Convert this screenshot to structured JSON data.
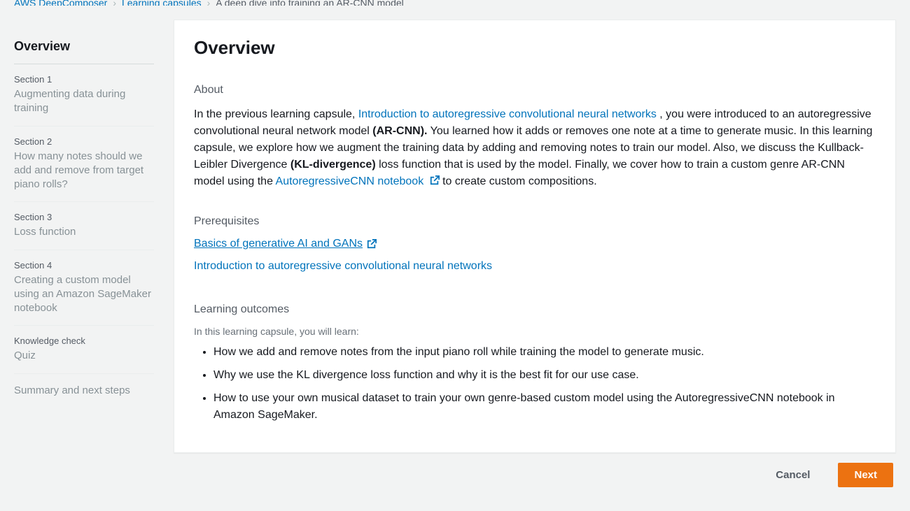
{
  "breadcrumb": {
    "item1": "AWS DeepComposer",
    "item2": "Learning capsules",
    "item3": "A deep dive into training an AR-CNN model"
  },
  "sidebar": {
    "heading": "Overview",
    "items": [
      {
        "label": "Section 1",
        "title": "Augmenting data during training"
      },
      {
        "label": "Section 2",
        "title": "How many notes should we add and remove from target piano rolls?"
      },
      {
        "label": "Section 3",
        "title": "Loss function"
      },
      {
        "label": "Section 4",
        "title": "Creating a custom model using an Amazon SageMaker notebook"
      },
      {
        "label": "Knowledge check",
        "title": "Quiz"
      },
      {
        "label": "",
        "title": "Summary and next steps"
      }
    ]
  },
  "main": {
    "title": "Overview",
    "about_label": "About",
    "about": {
      "p1": "In the previous learning capsule, ",
      "link1": "Introduction to autoregressive convolutional neural networks",
      "p2": " , you were introduced to an autoregressive convolutional neural network model ",
      "b1": "(AR-CNN).",
      "p3": " You learned how it adds or removes one note at a time to generate music. In this learning capsule, we explore how we augment the training data by adding and removing notes to train our model. Also, we discuss the Kullback-Leibler Divergence ",
      "b2": "(KL-divergence)",
      "p4": " loss function that is used by the model. Finally, we cover how to train a custom genre AR-CNN model using the ",
      "link2": "AutoregressiveCNN notebook",
      "p5": " to create custom compositions."
    },
    "prereq_label": "Prerequisites",
    "prereqs": [
      "Basics of generative AI and GANs",
      "Introduction to autoregressive convolutional neural networks"
    ],
    "outcomes_label": "Learning outcomes",
    "outcomes_intro": "In this learning capsule, you will learn:",
    "outcomes": [
      "How we add and remove notes from the input piano roll while training the model to generate music.",
      "Why we use the KL divergence loss function and why it is the best fit for our use case.",
      "How to use your own musical dataset to train your own genre-based custom model using the AutoregressiveCNN notebook in Amazon SageMaker."
    ]
  },
  "footer": {
    "cancel": "Cancel",
    "next": "Next"
  }
}
